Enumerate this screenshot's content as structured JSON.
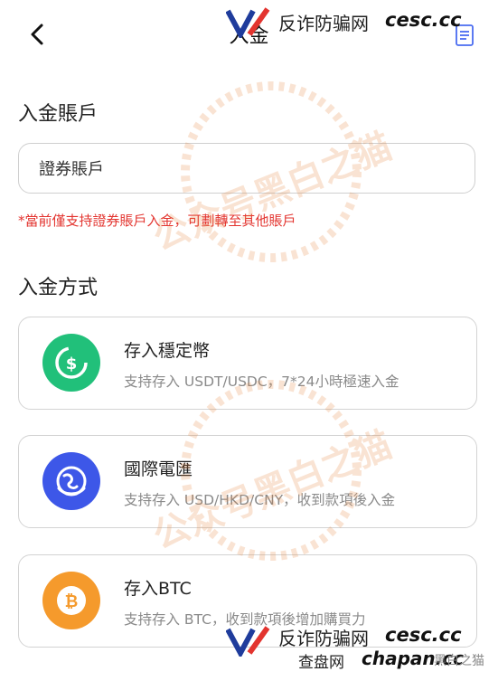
{
  "header": {
    "title": "入金"
  },
  "account_section": {
    "title": "入金賬戶",
    "field_value": "證券賬戶",
    "notice": "*當前僅支持證券賬戶入金，可劃轉至其他賬戶"
  },
  "method_section": {
    "title": "入金方式",
    "methods": [
      {
        "title": "存入穩定幣",
        "description": "支持存入 USDT/USDC，7*24小時極速入金",
        "icon": "stablecoin-dollar-icon",
        "color": "#21c07a"
      },
      {
        "title": "國際電匯",
        "description": "支持存入 USD/HKD/CNY，收到款項後入金",
        "icon": "globe-transfer-icon",
        "color": "#3d57e8"
      },
      {
        "title": "存入BTC",
        "description": "支持存入 BTC，收到款項後增加購買力",
        "icon": "bitcoin-icon",
        "color": "#f59a2c"
      }
    ]
  },
  "watermarks": {
    "stamp_text": "公众号黑白之猫",
    "top_logo_cn": "反诈防骗网",
    "top_logo_domain": "cesc.cc",
    "bottom_logo_cn": "反诈防骗网",
    "bottom_logo_domain": "cesc.cc",
    "bottom_logo_cn2": "查盘网",
    "bottom_logo_domain2": "chapan.cc",
    "bottom_stamp": "黑白之猫"
  }
}
